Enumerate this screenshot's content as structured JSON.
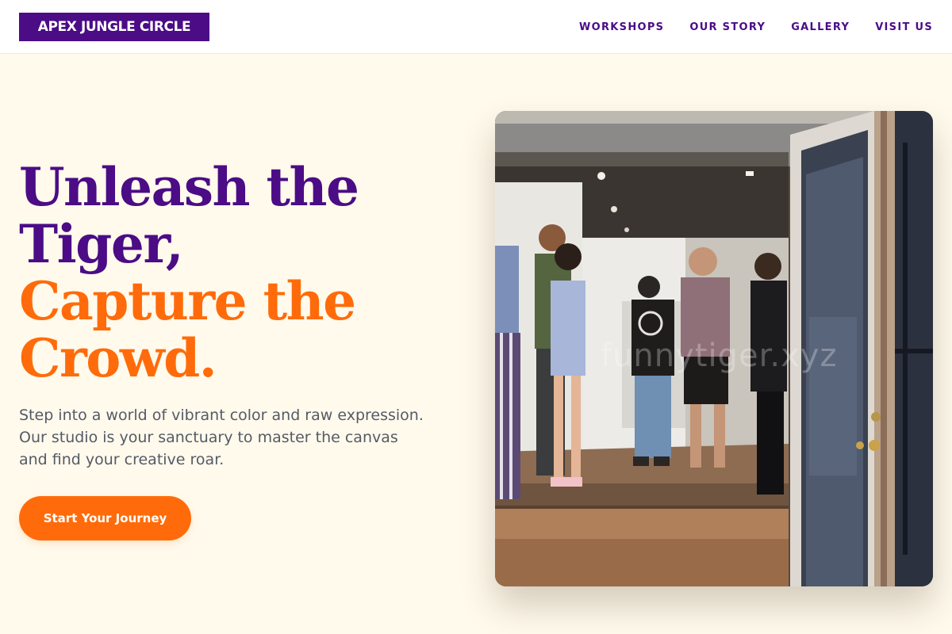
{
  "header": {
    "logo_text": "APEX JUNGLE CIRCLE",
    "nav": [
      {
        "label": "WORKSHOPS"
      },
      {
        "label": "OUR STORY"
      },
      {
        "label": "GALLERY"
      },
      {
        "label": "VISIT US"
      }
    ]
  },
  "hero": {
    "headline_line1": "Unleash the",
    "headline_line2": "Tiger,",
    "headline_line3": "Capture the",
    "headline_line4": "Crowd.",
    "description": "Step into a world of vibrant color and raw expression. Our studio is your sanctuary to master the canvas and find your creative roar.",
    "cta_label": "Start Your Journey"
  },
  "photo": {
    "watermark": "funnytiger.xyz"
  },
  "colors": {
    "brand_purple": "#4b0c86",
    "brand_orange": "#ff6b0a",
    "background": "#fffaec"
  }
}
